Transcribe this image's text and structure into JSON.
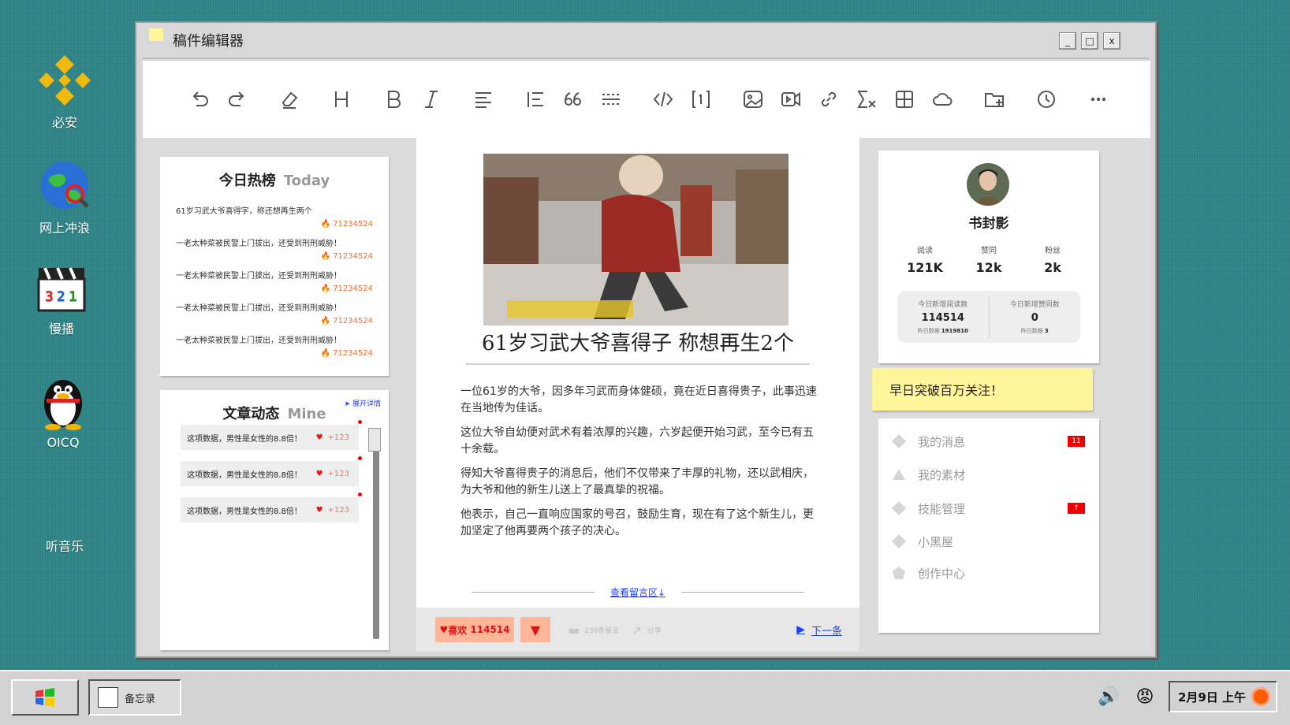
{
  "desktop": {
    "icons": [
      {
        "label": "必安",
        "icon": "binance-icon"
      },
      {
        "label": "网上冲浪",
        "icon": "globe-icon"
      },
      {
        "label": "慢播",
        "icon": "clapperboard-icon"
      },
      {
        "label": "OICQ",
        "icon": "penguin-icon"
      },
      {
        "label": "听音乐",
        "icon": "music-icon"
      }
    ]
  },
  "window": {
    "title": "稿件编辑器",
    "controls": {
      "minimize": "_",
      "maximize": "□",
      "close": "x"
    }
  },
  "toolbar": {
    "tools": [
      "undo",
      "redo",
      "eraser",
      "heading",
      "bold",
      "italic",
      "align",
      "list",
      "quote",
      "divider",
      "code",
      "footnote",
      "image",
      "video",
      "link",
      "formula",
      "table",
      "cloud",
      "folder-add",
      "history",
      "more"
    ]
  },
  "hot_list": {
    "title": "今日热榜",
    "subtitle": "Today",
    "items": [
      {
        "text": "61岁习武大爷喜得字，称还想再生两个",
        "count": "71234524"
      },
      {
        "text": "一老太种菜被民警上门拔出，还受到刑刑威胁！",
        "count": "71234524"
      },
      {
        "text": "一老太种菜被民警上门拔出，还受到刑刑威胁！",
        "count": "71234524"
      },
      {
        "text": "一老太种菜被民警上门拔出，还受到刑刑威胁！",
        "count": "71234524"
      },
      {
        "text": "一老太种菜被民警上门拔出，还受到刑刑威胁！",
        "count": "71234524"
      }
    ]
  },
  "activity": {
    "title": "文章动态",
    "subtitle": "Mine",
    "expand": "展开详情",
    "items": [
      {
        "text": "这项数据，男性是女性的8.8倍！",
        "likes": "+123"
      },
      {
        "text": "这项数据，男性是女性的8.8倍！",
        "likes": "+123"
      },
      {
        "text": "这项数据，男性是女性的8.8倍！",
        "likes": "+123"
      }
    ]
  },
  "article": {
    "title": "61岁习武大爷喜得子 称想再生2个",
    "paragraphs": [
      "一位61岁的大爷，因多年习武而身体健硕，竟在近日喜得贵子，此事迅速在当地传为佳话。",
      "这位大爷自幼便对武术有着浓厚的兴趣，六岁起便开始习武，至今已有五十余载。",
      "得知大爷喜得贵子的消息后，他们不仅带来了丰厚的礼物，还以武相庆，为大爷和他的新生儿送上了最真挚的祝福。",
      "他表示，自己一直响应国家的号召，鼓励生育，现在有了这个新生儿，更加坚定了他再要两个孩子的决心。"
    ],
    "comments_link": "查看留言区↓",
    "footer": {
      "like_label": "喜欢",
      "like_count": "114514",
      "comments": "238条留言",
      "share": "分享",
      "next": "下一条"
    }
  },
  "profile": {
    "name": "书封影",
    "stats": [
      {
        "label": "阅读",
        "value": "121K"
      },
      {
        "label": "赞同",
        "value": "12k"
      },
      {
        "label": "粉丝",
        "value": "2k"
      }
    ],
    "today": [
      {
        "label": "今日新增阅读数",
        "value": "114514",
        "sub_label": "昨日数据",
        "sub_value": "1919810"
      },
      {
        "label": "今日新增赞同数",
        "value": "0",
        "sub_label": "昨日数据",
        "sub_value": "3"
      }
    ]
  },
  "goal": "早日突破百万关注！",
  "menu": [
    {
      "label": "我的消息",
      "badge": "11"
    },
    {
      "label": "我的素材",
      "badge": ""
    },
    {
      "label": "技能管理",
      "badge": "↑"
    },
    {
      "label": "小黑屋",
      "badge": ""
    },
    {
      "label": "创作中心",
      "badge": ""
    }
  ],
  "taskbar": {
    "task": "备忘录",
    "clock": "2月9日 上午"
  },
  "colors": {
    "desktop": "#2f8587",
    "accent_yellow": "#fff59a",
    "link_blue": "#1e40ff",
    "hot_orange": "#ff6a2a",
    "badge_red": "#e00000"
  }
}
